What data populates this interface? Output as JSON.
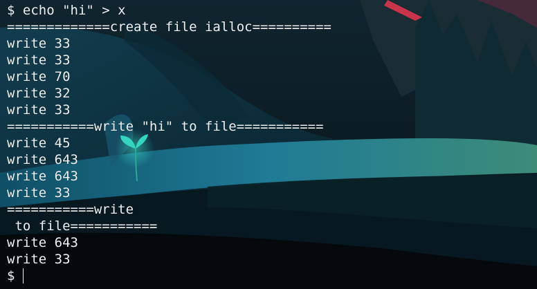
{
  "terminal": {
    "lines": [
      "$ echo \"hi\" > x",
      "=============create file ialloc==========",
      "write 33",
      "write 33",
      "write 70",
      "write 32",
      "write 33",
      "===========write \"hi\" to file===========",
      "write 45",
      "write 643",
      "write 643",
      "write 33",
      "===========write",
      " to file===========",
      "write 643",
      "write 33"
    ],
    "prompt": "$"
  },
  "colors": {
    "text": "#eef2f4",
    "sky": "#0b1a22",
    "hill": "#0f3a4c",
    "grass": "#1e6f8a",
    "sprout": "#35d6c0",
    "tree_accent": "#c8344a"
  }
}
